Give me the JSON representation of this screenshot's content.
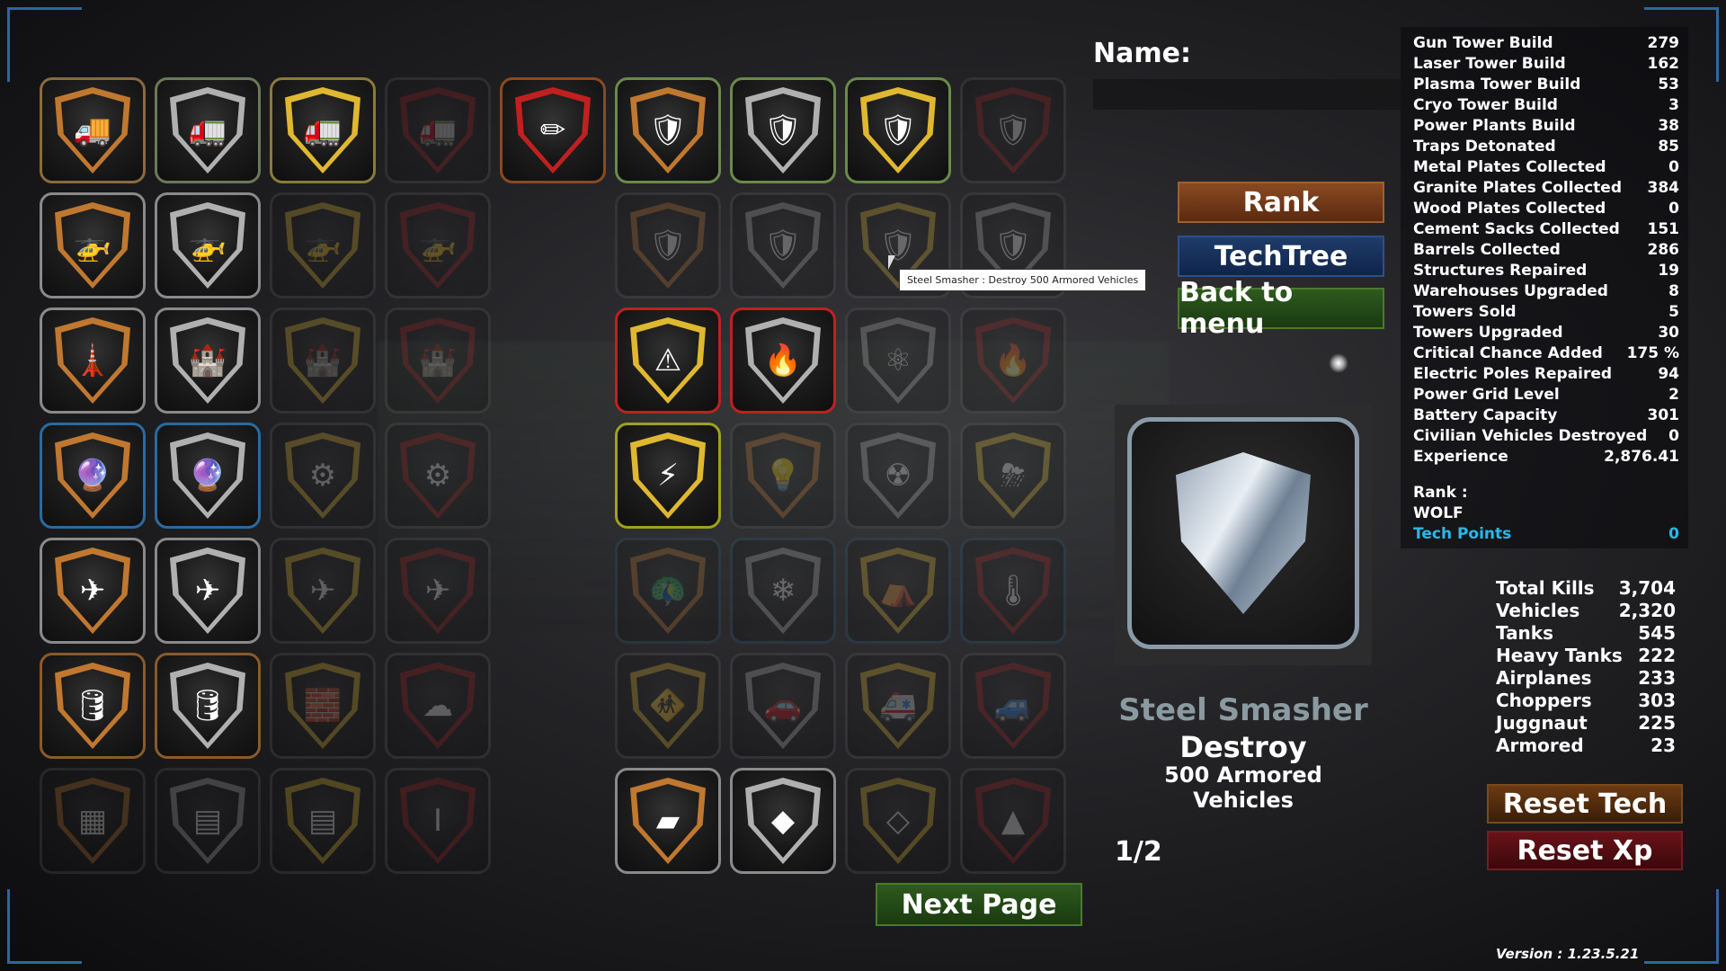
{
  "name_label": "Name:",
  "name_value": "",
  "buttons": {
    "rank": "Rank",
    "techtree": "TechTree",
    "back": "Back to menu",
    "next_page": "Next Page",
    "reset_tech": "Reset Tech",
    "reset_xp": "Reset Xp"
  },
  "tooltip": "Steel Smasher : Destroy 500 Armored Vehicles",
  "selected": {
    "title": "Steel Smasher",
    "line1": "Destroy",
    "line2": "500 Armored Vehicles"
  },
  "page": "1/2",
  "stats": [
    {
      "label": "Gun Tower Build",
      "value": "279"
    },
    {
      "label": "Laser Tower Build",
      "value": "162"
    },
    {
      "label": "Plasma Tower Build",
      "value": "53"
    },
    {
      "label": "Cryo Tower Build",
      "value": "3"
    },
    {
      "label": "Power Plants Build",
      "value": "38"
    },
    {
      "label": "Traps Detonated",
      "value": "85"
    },
    {
      "label": "Metal Plates Collected",
      "value": "0"
    },
    {
      "label": "Granite Plates Collected",
      "value": "384"
    },
    {
      "label": "Wood Plates Collected",
      "value": "0"
    },
    {
      "label": "Cement Sacks Collected",
      "value": "151"
    },
    {
      "label": "Barrels Collected",
      "value": "286"
    },
    {
      "label": "Structures Repaired",
      "value": "19"
    },
    {
      "label": "Warehouses Upgraded",
      "value": "8"
    },
    {
      "label": "Towers Sold",
      "value": "5"
    },
    {
      "label": "Towers Upgraded",
      "value": "30"
    },
    {
      "label": "Critical Chance Added",
      "value": "175 %"
    },
    {
      "label": "Electric Poles Repaired",
      "value": "94"
    },
    {
      "label": "Power Grid Level",
      "value": "2"
    },
    {
      "label": "Battery Capacity",
      "value": "301"
    },
    {
      "label": "Civilian Vehicles Destroyed",
      "value": "0"
    },
    {
      "label": "Experience",
      "value": "2,876.41"
    }
  ],
  "rank_label": "Rank :",
  "rank_value": "WOLF",
  "tech_points": {
    "label": "Tech Points",
    "value": "0"
  },
  "kills": [
    {
      "label": "Total Kills",
      "value": "3,704"
    },
    {
      "label": "Vehicles",
      "value": "2,320"
    },
    {
      "label": "Tanks",
      "value": "545"
    },
    {
      "label": "Heavy Tanks",
      "value": "222"
    },
    {
      "label": "Airplanes",
      "value": "233"
    },
    {
      "label": "Choppers",
      "value": "303"
    },
    {
      "label": "Juggnaut",
      "value": "225"
    },
    {
      "label": "Armored",
      "value": "23"
    }
  ],
  "version": "Version : 1.23.5.21",
  "tiles": [
    {
      "icon": "truck-icon",
      "glyph": "🚚",
      "border": "#8a6a40",
      "ring": "#c07830",
      "locked": false
    },
    {
      "icon": "military-truck-icon",
      "glyph": "🚛",
      "border": "#6a7a5a",
      "ring": "#b0b0b0",
      "locked": false
    },
    {
      "icon": "cargo-truck-icon",
      "glyph": "🚛",
      "border": "#8a7a3a",
      "ring": "#e0b830",
      "locked": false
    },
    {
      "icon": "truck-icon",
      "glyph": "🚛",
      "border": "#5a5a5a",
      "ring": "#a02020",
      "locked": true
    },
    {
      "icon": "pencil-icon",
      "glyph": "✏",
      "border": "#8a4a20",
      "ring": "#c02020",
      "locked": false
    },
    {
      "icon": "tank-icon",
      "glyph": "🛡",
      "border": "#6a8a4a",
      "ring": "#c07830",
      "locked": false
    },
    {
      "icon": "tank-icon",
      "glyph": "🛡",
      "border": "#6a8a4a",
      "ring": "#b0b0b0",
      "locked": false
    },
    {
      "icon": "tank-icon",
      "glyph": "🛡",
      "border": "#6a8a4a",
      "ring": "#e0b830",
      "locked": false
    },
    {
      "icon": "tank-icon",
      "glyph": "🛡",
      "border": "#5a5a5a",
      "ring": "#a02020",
      "locked": true
    },
    {
      "icon": "helicopter-icon",
      "glyph": "🚁",
      "border": "#8a8a8a",
      "ring": "#c07830",
      "locked": false
    },
    {
      "icon": "helicopter-icon",
      "glyph": "🚁",
      "border": "#8a8a8a",
      "ring": "#b0b0b0",
      "locked": false
    },
    {
      "icon": "helicopter-icon",
      "glyph": "🚁",
      "border": "#5a5a5a",
      "ring": "#e0b830",
      "locked": true
    },
    {
      "icon": "helicopter-icon",
      "glyph": "🚁",
      "border": "#5a5a5a",
      "ring": "#a02020",
      "locked": true
    },
    {
      "icon": "shield-icon",
      "glyph": "🛡",
      "border": "#5a5a5a",
      "ring": "#c07830",
      "locked": true
    },
    {
      "icon": "shield-icon",
      "glyph": "🛡",
      "border": "#5a5a5a",
      "ring": "#b0b0b0",
      "locked": true
    },
    {
      "icon": "shield-icon",
      "glyph": "🛡",
      "border": "#5a5a5a",
      "ring": "#e0b830",
      "locked": true
    },
    {
      "icon": "shield-icon",
      "glyph": "🛡",
      "border": "#5a5a5a",
      "ring": "#b0b0b0",
      "locked": true
    },
    {
      "icon": "watchtower-icon",
      "glyph": "🗼",
      "border": "#8a8a8a",
      "ring": "#c07830",
      "locked": false
    },
    {
      "icon": "cannon-tower-icon",
      "glyph": "🏰",
      "border": "#8a8a8a",
      "ring": "#b0b0b0",
      "locked": false
    },
    {
      "icon": "tower-icon",
      "glyph": "🏰",
      "border": "#5a5a5a",
      "ring": "#e0b830",
      "locked": true
    },
    {
      "icon": "tower-icon",
      "glyph": "🏰",
      "border": "#5a5a5a",
      "ring": "#a02020",
      "locked": true
    },
    {
      "icon": "laser-warning-icon",
      "glyph": "⚠",
      "border": "#c02020",
      "ring": "#e0b830",
      "locked": false
    },
    {
      "icon": "match-fire-icon",
      "glyph": "🔥",
      "border": "#c02020",
      "ring": "#b0b0b0",
      "locked": false
    },
    {
      "icon": "atom-icon",
      "glyph": "⚛",
      "border": "#5a5a5a",
      "ring": "#b0b0b0",
      "locked": true
    },
    {
      "icon": "fire-icon",
      "glyph": "🔥",
      "border": "#5a5a5a",
      "ring": "#a02020",
      "locked": true
    },
    {
      "icon": "plasma-ball-icon",
      "glyph": "🔮",
      "border": "#2a6aa0",
      "ring": "#c07830",
      "locked": false
    },
    {
      "icon": "plasma-orb-icon",
      "glyph": "🔮",
      "border": "#2a6aa0",
      "ring": "#b0b0b0",
      "locked": false
    },
    {
      "icon": "circuit-icon",
      "glyph": "⚙",
      "border": "#5a5a5a",
      "ring": "#e0b830",
      "locked": true
    },
    {
      "icon": "gear-icon",
      "glyph": "⚙",
      "border": "#5a5a5a",
      "ring": "#a02020",
      "locked": true
    },
    {
      "icon": "power-switch-icon",
      "glyph": "⚡",
      "border": "#a0a020",
      "ring": "#e0b830",
      "locked": false
    },
    {
      "icon": "lamp-icon",
      "glyph": "💡",
      "border": "#5a5a5a",
      "ring": "#c07830",
      "locked": true
    },
    {
      "icon": "radiation-icon",
      "glyph": "☢",
      "border": "#5a5a5a",
      "ring": "#b0b0b0",
      "locked": true
    },
    {
      "icon": "storm-cloud-icon",
      "glyph": "⛈",
      "border": "#5a5a5a",
      "ring": "#e0b830",
      "locked": true
    },
    {
      "icon": "paper-plane-icon",
      "glyph": "✈",
      "border": "#8a8a8a",
      "ring": "#c07830",
      "locked": false
    },
    {
      "icon": "airplane-icon",
      "glyph": "✈",
      "border": "#8a8a8a",
      "ring": "#b0b0b0",
      "locked": false
    },
    {
      "icon": "jet-icon",
      "glyph": "✈",
      "border": "#5a5a5a",
      "ring": "#e0b830",
      "locked": true
    },
    {
      "icon": "jet-icon",
      "glyph": "✈",
      "border": "#5a5a5a",
      "ring": "#a02020",
      "locked": true
    },
    {
      "icon": "peacock-icon",
      "glyph": "🦚",
      "border": "#2a5a7a",
      "ring": "#c07830",
      "locked": true
    },
    {
      "icon": "ice-icon",
      "glyph": "❄",
      "border": "#2a5a7a",
      "ring": "#b0b0b0",
      "locked": true
    },
    {
      "icon": "igloo-icon",
      "glyph": "⛺",
      "border": "#2a5a7a",
      "ring": "#e0b830",
      "locked": true
    },
    {
      "icon": "thermometer-icon",
      "glyph": "🌡",
      "border": "#2a5a7a",
      "ring": "#a02020",
      "locked": true
    },
    {
      "icon": "barrel-icon",
      "glyph": "🛢",
      "border": "#8a5a2a",
      "ring": "#c07830",
      "locked": false
    },
    {
      "icon": "barrel-icon",
      "glyph": "🛢",
      "border": "#8a5a2a",
      "ring": "#b0b0b0",
      "locked": false
    },
    {
      "icon": "bricks-icon",
      "glyph": "🧱",
      "border": "#5a5a5a",
      "ring": "#e0b830",
      "locked": true
    },
    {
      "icon": "mushroom-cloud-icon",
      "glyph": "☁",
      "border": "#5a5a5a",
      "ring": "#a02020",
      "locked": true
    },
    {
      "icon": "pedestrian-sign-icon",
      "glyph": "🚸",
      "border": "#5a5a5a",
      "ring": "#e0b830",
      "locked": true
    },
    {
      "icon": "car-icon",
      "glyph": "🚗",
      "border": "#5a5a5a",
      "ring": "#b0b0b0",
      "locked": true
    },
    {
      "icon": "ambulance-icon",
      "glyph": "🚑",
      "border": "#5a5a5a",
      "ring": "#e0b830",
      "locked": true
    },
    {
      "icon": "vehicle-wreck-icon",
      "glyph": "🚙",
      "border": "#5a5a5a",
      "ring": "#a02020",
      "locked": true
    },
    {
      "icon": "metal-plate-icon",
      "glyph": "▦",
      "border": "#5a5a5a",
      "ring": "#c07830",
      "locked": true
    },
    {
      "icon": "metal-plates-icon",
      "glyph": "▤",
      "border": "#5a5a5a",
      "ring": "#b0b0b0",
      "locked": true
    },
    {
      "icon": "plates-stack-icon",
      "glyph": "▤",
      "border": "#5a5a5a",
      "ring": "#e0b830",
      "locked": true
    },
    {
      "icon": "steel-beam-icon",
      "glyph": "I",
      "border": "#5a5a5a",
      "ring": "#a02020",
      "locked": true
    },
    {
      "icon": "wood-planks-icon",
      "glyph": "▰",
      "border": "#8a8a8a",
      "ring": "#c07830",
      "locked": false
    },
    {
      "icon": "granite-icon",
      "glyph": "◆",
      "border": "#8a8a8a",
      "ring": "#b0b0b0",
      "locked": false
    },
    {
      "icon": "cracked-stone-icon",
      "glyph": "◇",
      "border": "#5a5a5a",
      "ring": "#e0b830",
      "locked": true
    },
    {
      "icon": "rubble-icon",
      "glyph": "▲",
      "border": "#5a5a5a",
      "ring": "#a02020",
      "locked": true
    }
  ]
}
